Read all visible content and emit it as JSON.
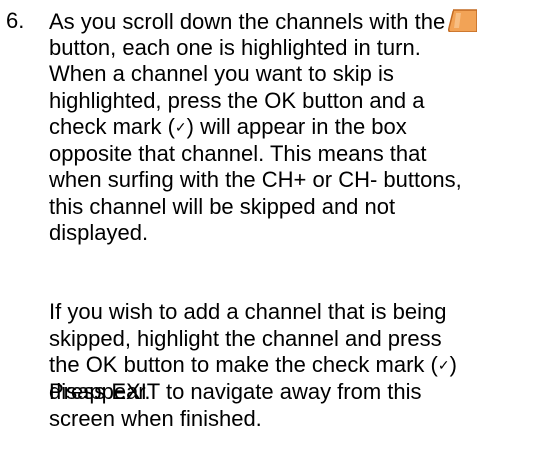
{
  "step": {
    "number": "6.",
    "paragraph1": {
      "line1": "As you scroll down the channels with the",
      "line2": "button, each one is highlighted in turn.",
      "line3": "When a channel you want to skip is",
      "line4": "highlighted, press the OK button and a",
      "line5_a": "check mark (",
      "line5_b": ") will appear in the box",
      "line6": "opposite that channel.  This means that",
      "line7": "when surfing with the CH+ or CH- buttons,",
      "line8": "this channel will be skipped and not",
      "line9": "displayed."
    },
    "paragraph2": {
      "line1": "If you wish to add a channel that is being",
      "line2": "skipped, highlight the channel and press",
      "line3_a": "the OK button to make the check mark (",
      "line3_b": ")",
      "line4": "disappear."
    },
    "paragraph3": {
      "line1": "Press EXIT to navigate away from this",
      "line2": "screen when finished."
    },
    "check_symbol": "✓",
    "icons": {
      "down_button": "orange-down-arrow-button-icon"
    },
    "colors": {
      "button_fill": "#F2A356",
      "button_stroke": "#C26A22",
      "text": "#000000"
    }
  }
}
